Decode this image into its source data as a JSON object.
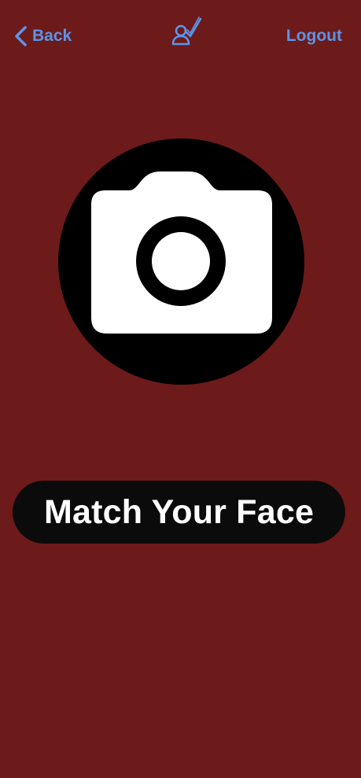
{
  "header": {
    "back_label": "Back",
    "logout_label": "Logout",
    "logo_icon": "person-check-icon"
  },
  "main": {
    "camera_icon": "camera-icon",
    "match_label": "Match Your Face"
  },
  "colors": {
    "background": "#6d1a1a",
    "accent": "#5b94e8",
    "button_bg": "#0b0b0b",
    "camera_circle": "#000000",
    "camera_body": "#ffffff"
  }
}
